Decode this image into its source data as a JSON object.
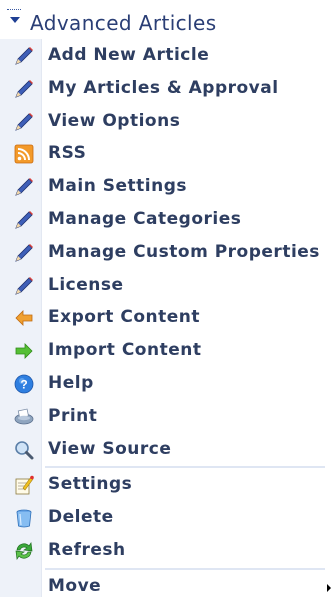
{
  "header": {
    "title": "Advanced Articles",
    "toggle_icon": "triangle-down-icon"
  },
  "colors": {
    "text": "#2e3e61",
    "strip": "#eef2f9",
    "separator": "#dfe6f3",
    "pencil": "#3e5fb8"
  },
  "menu": {
    "items": [
      {
        "label": "Add New Article",
        "icon": "pencil-icon"
      },
      {
        "label": "My Articles & Approval",
        "icon": "pencil-icon"
      },
      {
        "label": "View Options",
        "icon": "pencil-icon"
      },
      {
        "label": "RSS",
        "icon": "rss-icon"
      },
      {
        "label": "Main Settings",
        "icon": "pencil-icon"
      },
      {
        "label": "Manage Categories",
        "icon": "pencil-icon"
      },
      {
        "label": "Manage Custom Properties",
        "icon": "pencil-icon"
      },
      {
        "label": "License",
        "icon": "pencil-icon"
      },
      {
        "label": "Export Content",
        "icon": "arrow-left-icon"
      },
      {
        "label": "Import Content",
        "icon": "arrow-right-icon"
      },
      {
        "label": "Help",
        "icon": "help-icon"
      },
      {
        "label": "Print",
        "icon": "printer-icon"
      },
      {
        "label": "View Source",
        "icon": "magnifier-icon"
      }
    ],
    "module_items": [
      {
        "label": "Settings",
        "icon": "settings-icon"
      },
      {
        "label": "Delete",
        "icon": "trash-icon"
      },
      {
        "label": "Refresh",
        "icon": "refresh-icon"
      }
    ],
    "move": {
      "label": "Move",
      "icon": "submenu-arrow-icon"
    }
  }
}
